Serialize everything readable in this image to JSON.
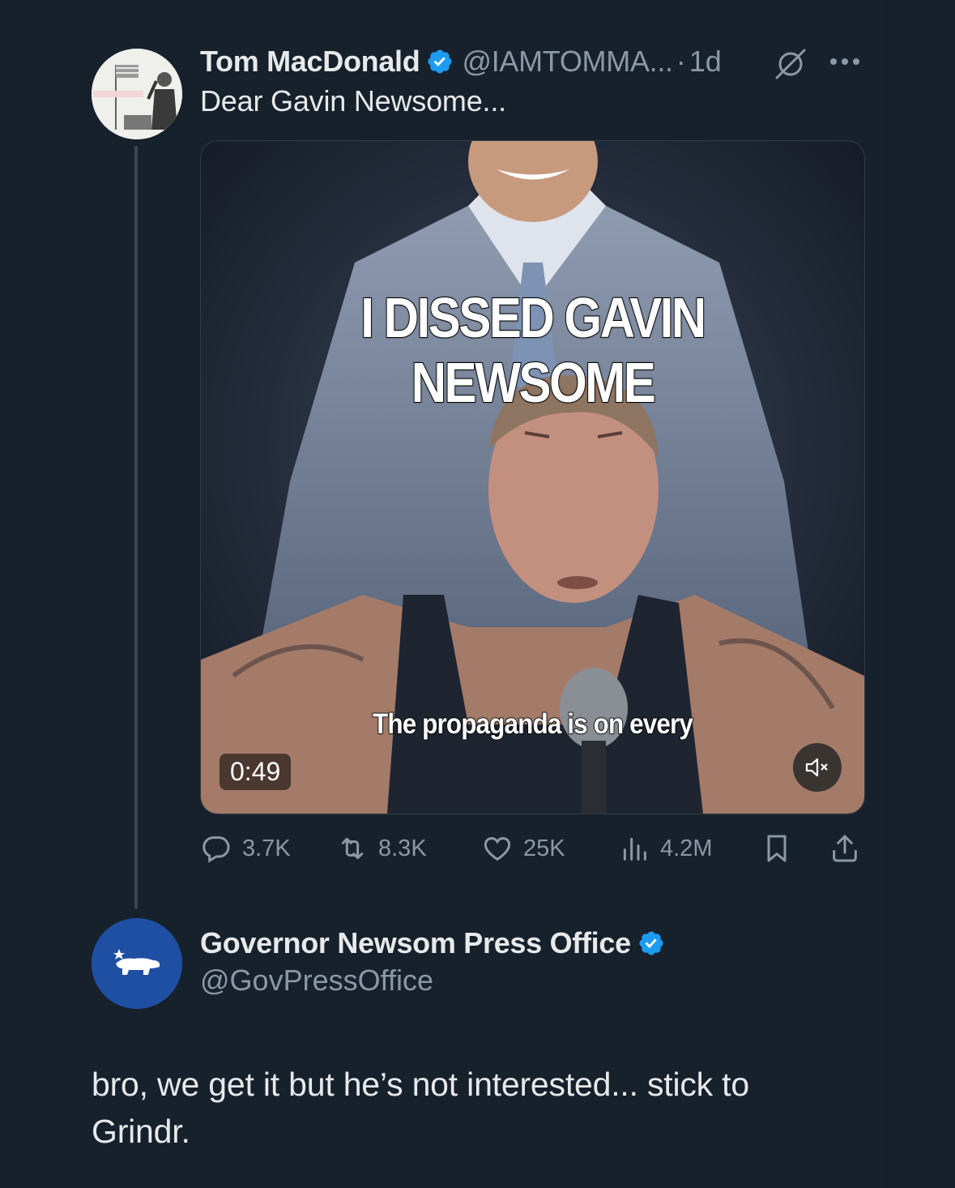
{
  "tweet": {
    "author_name": "Tom MacDonald",
    "author_handle": "@IAMTOMMA...",
    "separator": "·",
    "time": "1d",
    "text": "Dear Gavin Newsome...",
    "media": {
      "overlay_title": "I DISSED GAVIN NEWSOME",
      "caption": "The propaganda is on every",
      "duration": "0:49"
    },
    "stats": {
      "replies": "3.7K",
      "reposts": "8.3K",
      "likes": "25K",
      "views": "4.2M"
    }
  },
  "reply": {
    "author_name": "Governor Newsom Press Office",
    "author_handle": "@GovPressOffice",
    "text": "bro, we get it but he’s not interested... stick to Grindr."
  },
  "colors": {
    "background": "#17212c",
    "text": "#e7e9ea",
    "muted": "#8b98a5",
    "verified": "#1d9bf0",
    "governor_avatar": "#1f4fa3"
  },
  "icons": [
    "verified-badge-icon",
    "grok-icon",
    "more-icon",
    "reply-icon",
    "repost-icon",
    "like-icon",
    "views-icon",
    "bookmark-icon",
    "share-icon",
    "mute-icon",
    "bear-flag-icon"
  ]
}
